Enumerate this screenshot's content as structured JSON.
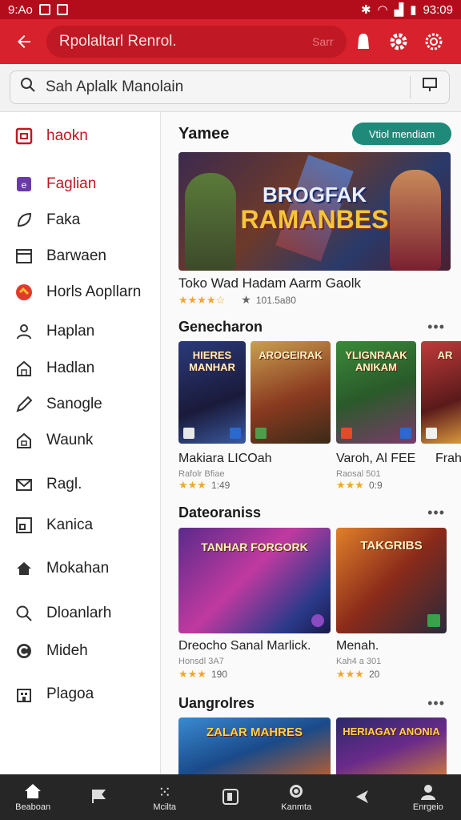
{
  "status": {
    "time_left": "9:Ao",
    "time_right": "93:09"
  },
  "appbar": {
    "search_value": "Rpolaltarl Renrol.",
    "search_hint": "Sarr"
  },
  "search": {
    "value": "Sah Aplalk Manolain"
  },
  "sidebar": {
    "items": [
      {
        "label": "haokn"
      },
      {
        "label": "Faglian"
      },
      {
        "label": "Faka"
      },
      {
        "label": "Barwaen"
      },
      {
        "label": "Horls Aopllarn"
      },
      {
        "label": "Haplan"
      },
      {
        "label": "Hadlan"
      },
      {
        "label": "Sanogle"
      },
      {
        "label": "Waunk"
      },
      {
        "label": "Ragl."
      },
      {
        "label": "Kanica"
      },
      {
        "label": "Mokahan"
      },
      {
        "label": "Dloanlarh"
      },
      {
        "label": "Mideh"
      },
      {
        "label": "Plagoa"
      }
    ]
  },
  "featured": {
    "title": "Yamee",
    "pill": "Vtiol mendiam",
    "hero_line1": "BROGFAK",
    "hero_line2": "RAMANBES",
    "game_title": "Toko Wad Hadam Aarm Gaolk",
    "game_meta": "101.5a80"
  },
  "sections": [
    {
      "title": "Genecharon",
      "games": [
        {
          "art": "HIERES MANHAR",
          "name": "Makiara LICOah",
          "dev": "Rafolr Bfiae",
          "rating": "1:49"
        },
        {
          "art": "AROGEIRAK",
          "name": "",
          "dev": "",
          "rating": ""
        },
        {
          "art": "YLIGNRAAK ANIKAM",
          "name": "Varoh, Al FEE",
          "dev": "Raosal 501",
          "rating": "0:9"
        },
        {
          "art": "AR",
          "name": "Frah",
          "dev": "",
          "rating": ""
        }
      ]
    },
    {
      "title": "Dateoraniss",
      "games": [
        {
          "art": "TANHAR FORGORK",
          "name": "Dreocho Sanal Marlick.",
          "dev": "Honsdl 3A7",
          "rating": "190"
        },
        {
          "art": "TAKGRIBS",
          "name": "Menah.",
          "dev": "Kah4 a 301",
          "rating": "20"
        }
      ]
    },
    {
      "title": "Uangrolres",
      "games": [
        {
          "art": "ZALAR MAHRES",
          "name": "",
          "dev": "",
          "rating": ""
        },
        {
          "art": "HERIAGAY ANONIA",
          "name": "",
          "dev": "",
          "rating": ""
        }
      ]
    }
  ],
  "bottomnav": [
    {
      "label": "Beaboan"
    },
    {
      "label": ""
    },
    {
      "label": "Mcilta"
    },
    {
      "label": ""
    },
    {
      "label": "Kanmta"
    },
    {
      "label": ""
    },
    {
      "label": "Enrgeio"
    }
  ],
  "colors": {
    "appbar": "#d7212c",
    "statusbar": "#b30d1c",
    "pill": "#1f8a7a",
    "star": "#f0a82a",
    "bottomnav": "#262626"
  }
}
